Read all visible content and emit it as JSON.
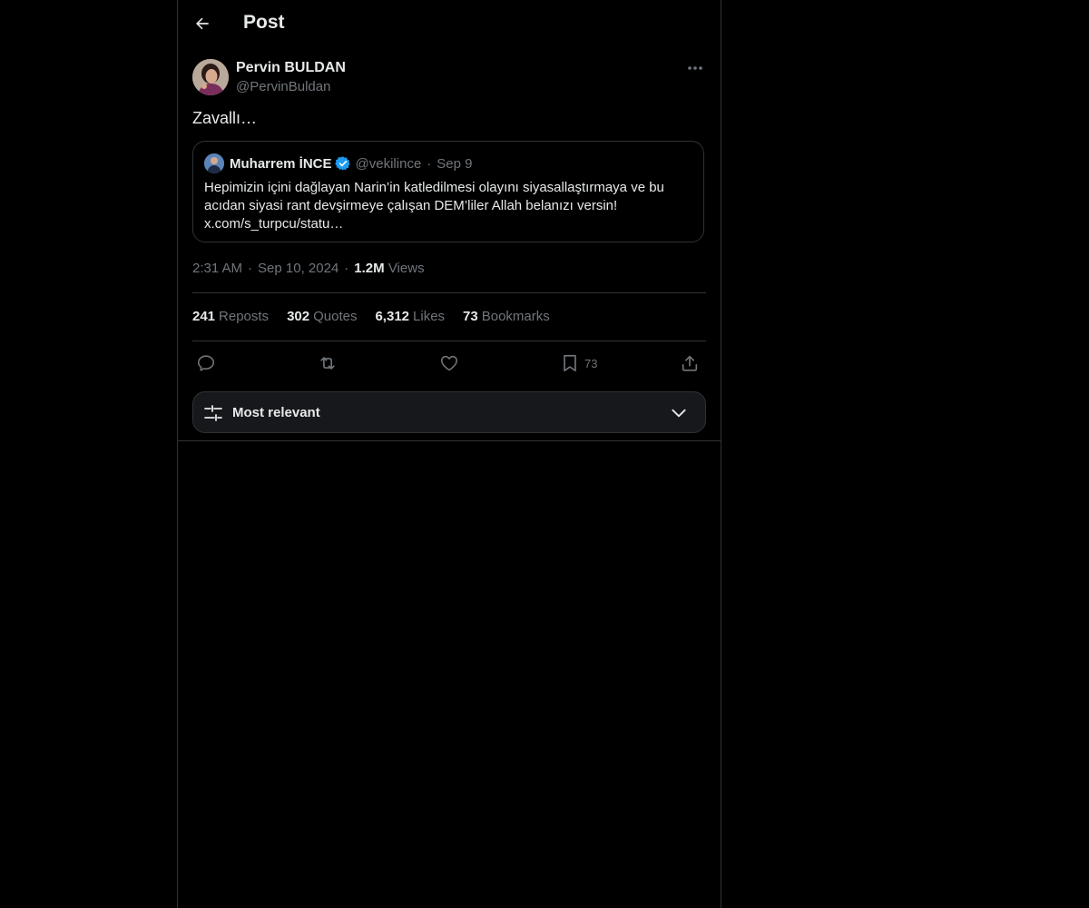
{
  "header": {
    "title": "Post",
    "back_icon": "arrow-left-icon"
  },
  "post": {
    "author": {
      "name": "Pervin BULDAN",
      "handle": "@PervinBuldan"
    },
    "text": "Zavallı…",
    "quoted": {
      "name": "Muharrem İNCE",
      "handle": "@vekilince",
      "separator": "·",
      "date": "Sep 9",
      "body": "Hepimizin içini dağlayan Narin’in katledilmesi olayını siyasallaştırmaya ve bu acıdan siyasi rant devşirmeye çalışan DEM’liler Allah belanızı versin! x.com/s_turpcu/statu…",
      "verified_color": "#1d9bf0"
    },
    "meta": {
      "time": "2:31 AM",
      "separator": "·",
      "date": "Sep 10, 2024",
      "views_count": "1.2M",
      "views_label": "Views"
    },
    "stats": [
      {
        "count": "241",
        "label": "Reposts"
      },
      {
        "count": "302",
        "label": "Quotes"
      },
      {
        "count": "6,312",
        "label": "Likes"
      },
      {
        "count": "73",
        "label": "Bookmarks"
      }
    ],
    "actions": {
      "reply_icon": "reply-icon",
      "repost_icon": "repost-icon",
      "like_icon": "heart-icon",
      "bookmark_icon": "bookmark-icon",
      "bookmark_count": "73",
      "share_icon": "share-icon"
    }
  },
  "replies_sort": {
    "label": "Most relevant"
  },
  "colors": {
    "background": "#000000",
    "text": "#e7e9ea",
    "muted": "#71767b",
    "border": "#2f3336",
    "accent": "#1d9bf0"
  }
}
